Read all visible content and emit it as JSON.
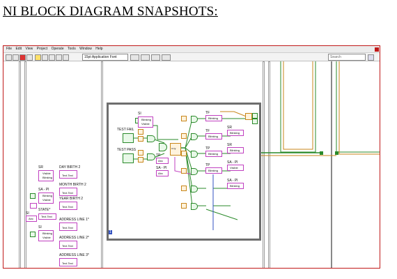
{
  "page": {
    "heading": "NI BLOCK DIAGRAM SNAPSHOTS:"
  },
  "menu": [
    "File",
    "Edit",
    "View",
    "Project",
    "Operate",
    "Tools",
    "Window",
    "Help"
  ],
  "toolbar": {
    "font": "15pt Application Font",
    "search_placeholder": "Search"
  },
  "left_column": {
    "groups": [
      {
        "label": "SR",
        "items": [
          "Visible",
          "Blinking"
        ]
      },
      {
        "label": "SA - PI",
        "items": [
          "Blinking",
          "Visible"
        ]
      },
      {
        "label": "STATE*",
        "items": [
          "Text.Text"
        ]
      },
      {
        "label": "SI",
        "items": [
          "Abc"
        ]
      },
      {
        "label": "SI",
        "items": [
          "Blinking",
          "Visible"
        ]
      }
    ],
    "fields": [
      {
        "label": "DAY BIRTH 2",
        "items": [
          "Text.Text"
        ]
      },
      {
        "label": "MONTH BIRTH 2",
        "items": [
          "Text.Text"
        ]
      },
      {
        "label": "YEAR BIRTH 2",
        "items": [
          "Text.Text"
        ]
      },
      {
        "label": "ADDRESS LINE 1*",
        "items": [
          "Text.Text"
        ]
      },
      {
        "label": "ADDRESS LINE 2*",
        "items": [
          "Text.Text"
        ]
      },
      {
        "label": "ADDRESS LINE 3*",
        "items": [
          "Text.Text"
        ]
      }
    ]
  },
  "structure": {
    "labels": {
      "si": "SI",
      "blinking": "Blinking",
      "visible": "Visible",
      "test_fail": "TEST FAIL",
      "test_pass": "TEST PASS",
      "tp": "TP",
      "sa_pi": "SA - PI",
      "abc": "Abc",
      "xy": "x=y",
      "tf": "TF",
      "sr": "SR",
      "corner": "1"
    },
    "right_nodes": [
      {
        "label": "TF",
        "items": [
          "Blinking"
        ]
      },
      {
        "label": "TF",
        "items": [
          "Blinking"
        ]
      },
      {
        "label": "TP",
        "items": [
          "Blinking"
        ]
      },
      {
        "label": "TP",
        "items": [
          "Blinking"
        ]
      },
      {
        "label": "SR",
        "items": [
          "Blinking"
        ]
      },
      {
        "label": "SR",
        "items": [
          "Blinking"
        ]
      },
      {
        "label": "SA - PI",
        "items": [
          "Visible"
        ]
      },
      {
        "label": "SA - PI",
        "items": [
          "Blinking"
        ]
      }
    ]
  },
  "colors": {
    "frame_border": "#c01818",
    "wire_green": "#2a8a2a",
    "wire_orange": "#c8861a",
    "wire_pink": "#c040c0"
  }
}
